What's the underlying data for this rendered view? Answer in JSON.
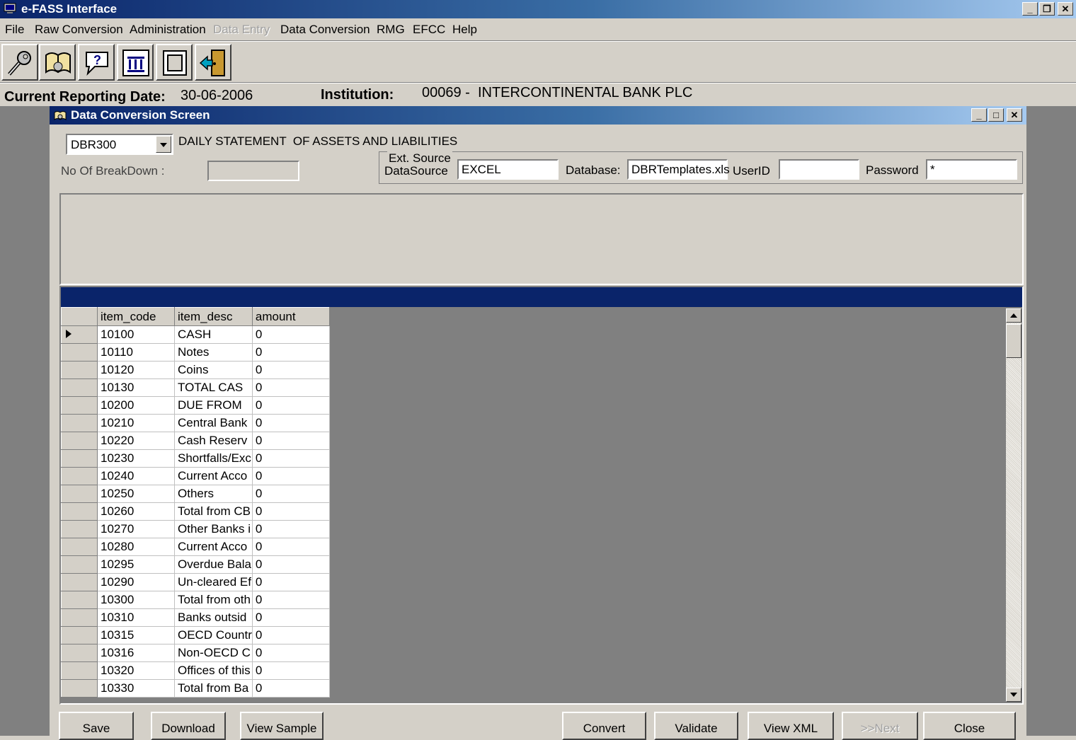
{
  "app": {
    "title": "e-FASS Interface"
  },
  "menu": [
    {
      "label": "File",
      "disabled": false
    },
    {
      "label": "Raw Conversion",
      "disabled": false
    },
    {
      "label": "Administration",
      "disabled": false
    },
    {
      "label": "Data Entry",
      "disabled": true
    },
    {
      "label": "Data Conversion",
      "disabled": false
    },
    {
      "label": "RMG",
      "disabled": false
    },
    {
      "label": "EFCC",
      "disabled": false
    },
    {
      "label": "Help",
      "disabled": false
    }
  ],
  "toolbar": [
    {
      "icon": "key-icon"
    },
    {
      "icon": "book-icon"
    },
    {
      "icon": "help-balloon-icon"
    },
    {
      "icon": "institution-icon"
    },
    {
      "icon": "document-icon"
    },
    {
      "icon": "exit-door-icon"
    }
  ],
  "info": {
    "reporting_date_label": "Current Reporting Date:",
    "reporting_date": "30-06-2006",
    "institution_label": "Institution:",
    "institution": "00069 -  INTERCONTINENTAL BANK PLC"
  },
  "screen": {
    "title": "Data Conversion Screen",
    "template_code": "DBR300",
    "template_desc": "DAILY STATEMENT  OF ASSETS AND LIABILITIES",
    "breakdown_label": "No Of BreakDown :",
    "breakdown_value": "",
    "datasource_group": "Ext. Source",
    "datasource_label": "DataSource",
    "datasource_value": "EXCEL",
    "database_label": "Database:",
    "database_value": "DBRTemplates.xls",
    "userid_label": "UserID",
    "userid_value": "",
    "password_label": "Password",
    "password_value": "*"
  },
  "grid": {
    "columns": [
      "item_code",
      "item_desc",
      "amount"
    ],
    "rows": [
      [
        "10100",
        "CASH",
        "0"
      ],
      [
        "10110",
        "Notes",
        "0"
      ],
      [
        "10120",
        "Coins",
        "0"
      ],
      [
        "10130",
        "TOTAL CAS",
        "0"
      ],
      [
        "10200",
        "DUE FROM",
        "0"
      ],
      [
        "10210",
        "Central Bank",
        "0"
      ],
      [
        "10220",
        "Cash Reserv",
        "0"
      ],
      [
        "10230",
        "Shortfalls/Exc",
        "0"
      ],
      [
        "10240",
        "Current Acco",
        "0"
      ],
      [
        "10250",
        "Others",
        "0"
      ],
      [
        "10260",
        "Total from CB",
        "0"
      ],
      [
        "10270",
        "Other Banks i",
        "0"
      ],
      [
        "10280",
        "Current Acco",
        "0"
      ],
      [
        "10295",
        "Overdue Bala",
        "0"
      ],
      [
        "10290",
        "Un-cleared Ef",
        "0"
      ],
      [
        "10300",
        "Total from oth",
        "0"
      ],
      [
        "10310",
        "Banks outsid",
        "0"
      ],
      [
        "10315",
        "OECD Countr",
        "0"
      ],
      [
        "10316",
        "Non-OECD C",
        "0"
      ],
      [
        "10320",
        "Offices of this",
        "0"
      ],
      [
        "10330",
        "Total from Ba",
        "0"
      ]
    ]
  },
  "buttons": {
    "save": "Save",
    "download": "Download",
    "view_sample": "View Sample",
    "convert": "Convert",
    "validate": "Validate",
    "view_xml": "View XML",
    "next": ">>Next",
    "close": "Close"
  },
  "colors": {
    "title_bar": "#0a246a",
    "window_bg": "#d4d0c8",
    "mdi_bg": "#808080"
  }
}
